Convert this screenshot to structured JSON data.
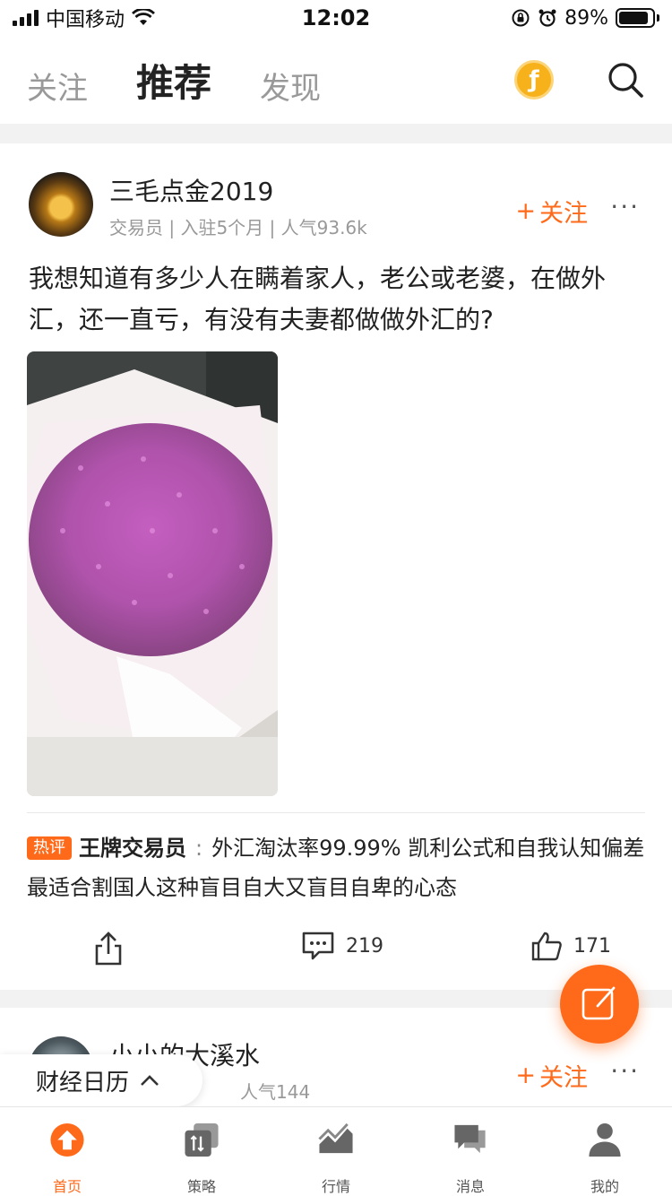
{
  "status_bar": {
    "carrier": "中国移动",
    "time": "12:02",
    "battery_text": "89%",
    "battery_level": 0.89
  },
  "top_nav": {
    "tabs": [
      {
        "label": "关注",
        "active": false
      },
      {
        "label": "推荐",
        "active": true
      },
      {
        "label": "发现",
        "active": false
      }
    ],
    "coin_symbol": "ƒ"
  },
  "posts": [
    {
      "author": "三毛点金2019",
      "meta": "交易员 | 入驻5个月 | 人气93.6k",
      "follow_label": "关注",
      "follow_plus": "+",
      "more": "···",
      "text": "我想知道有多少人在瞒着家人，老公或老婆，在做外汇，还一直亏，有没有夫妻都做做外汇的?",
      "hot_comment": {
        "badge": "热评",
        "user": "王牌交易员",
        "separator": ":",
        "text": "外汇淘汰率99.99%  凯利公式和自我认知偏差最适合割国人这种盲目自大又盲目自卑的心态"
      },
      "comments_count": "219",
      "likes_count": "171"
    },
    {
      "author": "小小的大溪水",
      "meta": "人气144",
      "follow_label": "关注",
      "follow_plus": "+",
      "more": "···"
    }
  ],
  "calendar_pill": {
    "label": "财经日历",
    "chevron": "^"
  },
  "tabbar": [
    {
      "label": "首页",
      "icon": "home-icon",
      "active": true
    },
    {
      "label": "策略",
      "icon": "strategy-icon",
      "active": false
    },
    {
      "label": "行情",
      "icon": "market-icon",
      "active": false
    },
    {
      "label": "消息",
      "icon": "message-icon",
      "active": false
    },
    {
      "label": "我的",
      "icon": "profile-icon",
      "active": false
    }
  ],
  "colors": {
    "accent": "#ff6a1a",
    "coin": "#f7b11b",
    "muted_text": "#999999"
  }
}
